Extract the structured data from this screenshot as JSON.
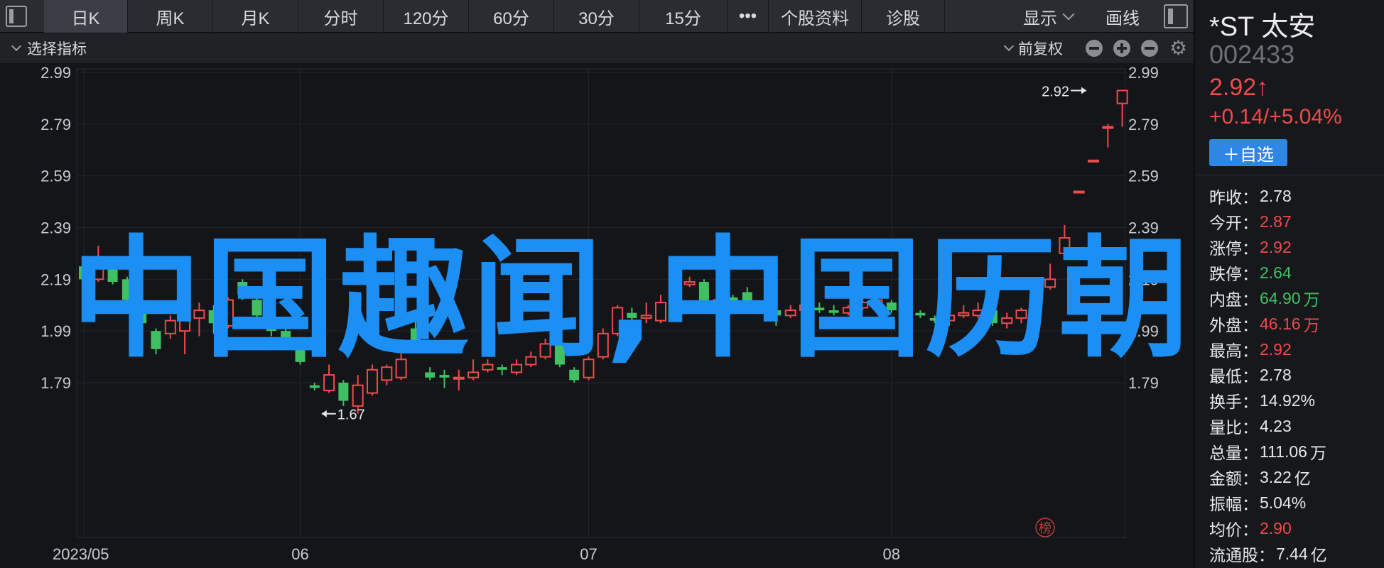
{
  "topbar": {
    "tabs": [
      "日K",
      "周K",
      "月K",
      "分时",
      "120分",
      "60分",
      "30分",
      "15分",
      "•••",
      "个股资料",
      "诊股"
    ],
    "active_tab": "日K",
    "display_label": "显示",
    "draw_label": "画线"
  },
  "indicator_bar": {
    "select_label": "选择指标",
    "adjust_label": "前复权"
  },
  "overlay_text": "中国趣闻,中国历朝历",
  "stock": {
    "name": "*ST 太安",
    "code": "002433",
    "price": "2.92↑",
    "change": "+0.14/+5.04%",
    "add_watch": "＋自选"
  },
  "stats": [
    {
      "k": "昨收：",
      "v": "2.78",
      "color": "white",
      "u": ""
    },
    {
      "k": "今开：",
      "v": "2.87",
      "color": "red",
      "u": ""
    },
    {
      "k": "涨停：",
      "v": "2.92",
      "color": "red",
      "u": ""
    },
    {
      "k": "跌停：",
      "v": "2.64",
      "color": "green",
      "u": ""
    },
    {
      "k": "内盘：",
      "v": "64.90",
      "color": "green",
      "u": "万"
    },
    {
      "k": "外盘：",
      "v": "46.16",
      "color": "red",
      "u": "万"
    },
    {
      "k": "最高：",
      "v": "2.92",
      "color": "red",
      "u": ""
    },
    {
      "k": "最低：",
      "v": "2.78",
      "color": "white",
      "u": ""
    },
    {
      "k": "换手：",
      "v": "14.92%",
      "color": "white",
      "u": ""
    },
    {
      "k": "量比：",
      "v": "4.23",
      "color": "white",
      "u": ""
    },
    {
      "k": "总量：",
      "v": "111.06",
      "color": "white",
      "u": "万"
    },
    {
      "k": "金额：",
      "v": "3.22",
      "color": "white",
      "u": "亿"
    },
    {
      "k": "振幅：",
      "v": "5.04%",
      "color": "white",
      "u": ""
    },
    {
      "k": "均价：",
      "v": "2.90",
      "color": "red",
      "u": ""
    },
    {
      "k": "流通股：",
      "v": "7.44",
      "color": "white",
      "u": "亿"
    }
  ],
  "colors": {
    "up": "#ee4b4b",
    "down": "#3fc163",
    "accent": "#2f86e4",
    "overlay": "#1b8ff4"
  },
  "icons": [
    "layout-icon",
    "chevron-down-icon",
    "minus-circle-icon",
    "plus-circle-icon",
    "gear-icon",
    "watermark-seal-icon"
  ],
  "chart_data": {
    "type": "candlestick",
    "ylim": [
      1.62,
      3.02
    ],
    "yticks": [
      "2.99",
      "2.79",
      "2.59",
      "2.39",
      "2.19",
      "1.99",
      "1.79"
    ],
    "ytick_values": [
      2.99,
      2.79,
      2.59,
      2.39,
      2.19,
      1.99,
      1.79
    ],
    "xtick_labels": [
      {
        "label": "2023/05",
        "index": 0
      },
      {
        "label": "06",
        "index": 15
      },
      {
        "label": "07",
        "index": 35
      },
      {
        "label": "08",
        "index": 56
      }
    ],
    "annotations": [
      {
        "text": "2.92",
        "index": 70,
        "value": 2.92,
        "side": "left"
      },
      {
        "text": "1.67",
        "index": 16,
        "value": 1.67,
        "side": "right"
      }
    ],
    "watermark": "榜",
    "candles": [
      [
        2.24,
        2.19,
        2.26,
        2.16
      ],
      [
        2.19,
        2.27,
        2.32,
        2.18
      ],
      [
        2.27,
        2.18,
        2.28,
        2.17
      ],
      [
        2.19,
        2.11,
        2.2,
        2.1
      ],
      [
        2.07,
        2.02,
        2.08,
        2.01
      ],
      [
        1.99,
        1.92,
        2.0,
        1.9
      ],
      [
        1.98,
        2.03,
        2.05,
        1.96
      ],
      [
        1.99,
        2.06,
        2.08,
        1.9
      ],
      [
        2.04,
        2.07,
        2.1,
        1.97
      ],
      [
        2.07,
        2.02,
        2.09,
        1.98
      ],
      [
        2.01,
        2.11,
        2.12,
        2.0
      ],
      [
        2.18,
        2.13,
        2.19,
        2.11
      ],
      [
        2.11,
        2.05,
        2.12,
        2.04
      ],
      [
        2.03,
        1.99,
        2.05,
        1.97
      ],
      [
        1.99,
        1.96,
        2.01,
        1.95
      ],
      [
        1.96,
        1.87,
        1.96,
        1.86
      ],
      [
        1.78,
        1.77,
        1.79,
        1.76
      ],
      [
        1.76,
        1.82,
        1.86,
        1.75
      ],
      [
        1.79,
        1.72,
        1.8,
        1.7
      ],
      [
        1.7,
        1.78,
        1.82,
        1.67
      ],
      [
        1.75,
        1.84,
        1.86,
        1.74
      ],
      [
        1.8,
        1.85,
        1.86,
        1.78
      ],
      [
        1.81,
        1.88,
        1.91,
        1.8
      ],
      [
        2.0,
        1.94,
        2.03,
        1.93
      ],
      [
        1.83,
        1.81,
        1.85,
        1.8
      ],
      [
        1.82,
        1.81,
        1.84,
        1.77
      ],
      [
        1.81,
        1.81,
        1.84,
        1.76
      ],
      [
        1.81,
        1.83,
        1.88,
        1.8
      ],
      [
        1.84,
        1.86,
        1.88,
        1.83
      ],
      [
        1.85,
        1.84,
        1.86,
        1.82
      ],
      [
        1.83,
        1.86,
        1.88,
        1.82
      ],
      [
        1.86,
        1.89,
        1.91,
        1.85
      ],
      [
        1.89,
        1.94,
        1.96,
        1.88
      ],
      [
        1.94,
        1.86,
        1.95,
        1.85
      ],
      [
        1.84,
        1.8,
        1.85,
        1.79
      ],
      [
        1.81,
        1.88,
        1.89,
        1.8
      ],
      [
        1.89,
        1.98,
        2.0,
        1.88
      ],
      [
        1.98,
        2.08,
        2.09,
        1.97
      ],
      [
        2.06,
        2.04,
        2.08,
        2.02
      ],
      [
        2.04,
        2.05,
        2.1,
        2.02
      ],
      [
        2.03,
        2.1,
        2.13,
        2.02
      ],
      [
        2.09,
        2.17,
        2.18,
        2.08
      ],
      [
        2.17,
        2.18,
        2.2,
        2.16
      ],
      [
        2.18,
        2.1,
        2.19,
        2.08
      ],
      [
        2.09,
        2.11,
        2.12,
        2.08
      ],
      [
        2.12,
        2.09,
        2.13,
        2.08
      ],
      [
        2.14,
        2.08,
        2.16,
        2.07
      ],
      [
        2.08,
        2.07,
        2.1,
        2.06
      ],
      [
        2.07,
        2.05,
        2.1,
        2.01
      ],
      [
        2.05,
        2.07,
        2.09,
        2.04
      ],
      [
        2.07,
        2.09,
        2.11,
        2.06
      ],
      [
        2.08,
        2.07,
        2.1,
        2.06
      ],
      [
        2.07,
        2.06,
        2.09,
        2.05
      ],
      [
        2.06,
        2.08,
        2.09,
        2.05
      ],
      [
        2.08,
        2.1,
        2.12,
        2.07
      ],
      [
        2.1,
        2.11,
        2.12,
        2.09
      ],
      [
        2.1,
        2.07,
        2.11,
        2.06
      ],
      [
        2.07,
        2.06,
        2.08,
        2.05
      ],
      [
        2.06,
        2.05,
        2.07,
        2.04
      ],
      [
        2.04,
        2.03,
        2.05,
        2.02
      ],
      [
        2.03,
        2.05,
        2.07,
        2.01
      ],
      [
        2.05,
        2.06,
        2.09,
        2.04
      ],
      [
        2.05,
        2.07,
        2.1,
        2.04
      ],
      [
        2.07,
        2.02,
        2.08,
        2.01
      ],
      [
        2.02,
        2.04,
        2.06,
        2.0
      ],
      [
        2.04,
        2.07,
        2.08,
        2.02
      ],
      [
        2.05,
        2.07,
        2.08,
        2.04
      ],
      [
        2.16,
        2.19,
        2.25,
        2.15
      ],
      [
        2.29,
        2.35,
        2.4,
        2.28
      ],
      [
        2.53,
        2.53,
        2.53,
        2.53
      ],
      [
        2.65,
        2.65,
        2.65,
        2.65
      ],
      [
        2.78,
        2.78,
        2.79,
        2.7
      ],
      [
        2.87,
        2.92,
        2.92,
        2.78
      ]
    ]
  }
}
